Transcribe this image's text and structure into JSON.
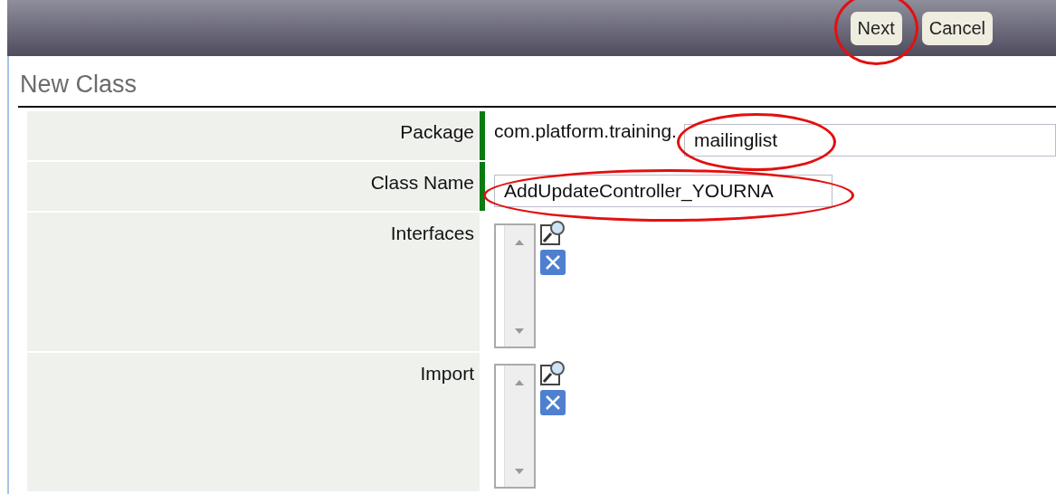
{
  "toolbar": {
    "buttons": [
      {
        "label": "Next",
        "highlighted": true
      },
      {
        "label": "Cancel",
        "highlighted": false
      }
    ]
  },
  "title": "New Class",
  "form": {
    "rows": [
      {
        "label": "Package",
        "required": true,
        "kind": "prefixed",
        "prefix": "com.platform.training.",
        "value": "mailinglist",
        "highlighted": true
      },
      {
        "label": "Class Name",
        "required": true,
        "kind": "text",
        "value": "AddUpdateController_YOURNA",
        "highlighted": true
      },
      {
        "label": "Interfaces",
        "required": false,
        "kind": "list"
      },
      {
        "label": "Import",
        "required": false,
        "kind": "list"
      }
    ]
  }
}
